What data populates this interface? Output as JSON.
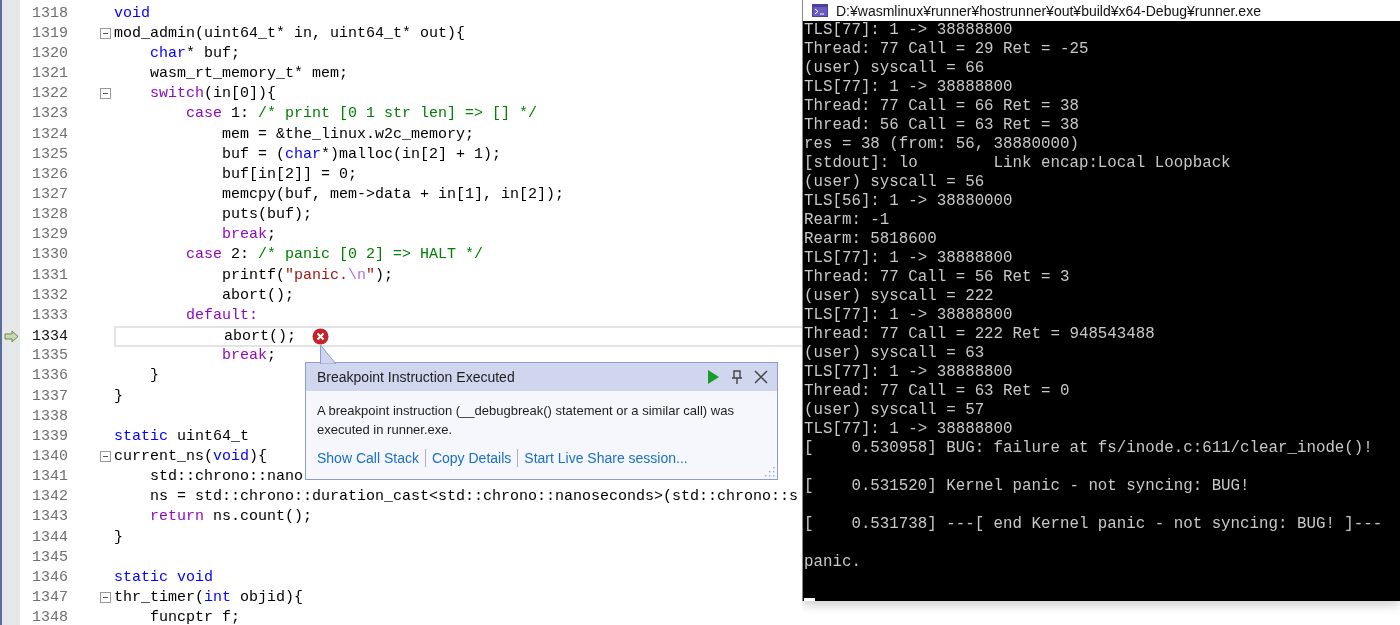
{
  "editor": {
    "lines": [
      {
        "number": "1318",
        "current": false,
        "fold": false,
        "error": false,
        "tokens": [
          {
            "kind": "keyword",
            "text": "void"
          }
        ]
      },
      {
        "number": "1319",
        "current": false,
        "fold": true,
        "error": false,
        "tokens": [
          {
            "kind": "plain",
            "text": "mod_admin(uint64_t* in, uint64_t* out){"
          }
        ]
      },
      {
        "number": "1320",
        "current": false,
        "fold": false,
        "error": false,
        "tokens": [
          {
            "kind": "keyword",
            "text": "    char"
          },
          {
            "kind": "plain",
            "text": "* buf;"
          }
        ]
      },
      {
        "number": "1321",
        "current": false,
        "fold": false,
        "error": false,
        "tokens": [
          {
            "kind": "plain",
            "text": "    wasm_rt_memory_t* mem;"
          }
        ]
      },
      {
        "number": "1322",
        "current": false,
        "fold": true,
        "error": false,
        "tokens": [
          {
            "kind": "control",
            "text": "    switch"
          },
          {
            "kind": "plain",
            "text": "(in[0]){"
          }
        ]
      },
      {
        "number": "1323",
        "current": false,
        "fold": false,
        "error": false,
        "tokens": [
          {
            "kind": "control",
            "text": "        case"
          },
          {
            "kind": "plain",
            "text": " 1: "
          },
          {
            "kind": "comment",
            "text": "/* print [0 1 str len] => [] */"
          }
        ]
      },
      {
        "number": "1324",
        "current": false,
        "fold": false,
        "error": false,
        "tokens": [
          {
            "kind": "plain",
            "text": "            mem = &the_linux.w2c_memory;"
          }
        ]
      },
      {
        "number": "1325",
        "current": false,
        "fold": false,
        "error": false,
        "tokens": [
          {
            "kind": "plain",
            "text": "            buf = ("
          },
          {
            "kind": "keyword",
            "text": "char"
          },
          {
            "kind": "plain",
            "text": "*)malloc(in[2] + 1);"
          }
        ]
      },
      {
        "number": "1326",
        "current": false,
        "fold": false,
        "error": false,
        "tokens": [
          {
            "kind": "plain",
            "text": "            buf[in[2]] = 0;"
          }
        ]
      },
      {
        "number": "1327",
        "current": false,
        "fold": false,
        "error": false,
        "tokens": [
          {
            "kind": "plain",
            "text": "            memcpy(buf, mem->data + in[1], in[2]);"
          }
        ]
      },
      {
        "number": "1328",
        "current": false,
        "fold": false,
        "error": false,
        "tokens": [
          {
            "kind": "plain",
            "text": "            puts(buf);"
          }
        ]
      },
      {
        "number": "1329",
        "current": false,
        "fold": false,
        "error": false,
        "tokens": [
          {
            "kind": "control",
            "text": "            break"
          },
          {
            "kind": "plain",
            "text": ";"
          }
        ]
      },
      {
        "number": "1330",
        "current": false,
        "fold": false,
        "error": false,
        "tokens": [
          {
            "kind": "control",
            "text": "        case"
          },
          {
            "kind": "plain",
            "text": " 2: "
          },
          {
            "kind": "comment",
            "text": "/* panic [0 2] => HALT */"
          }
        ]
      },
      {
        "number": "1331",
        "current": false,
        "fold": false,
        "error": false,
        "tokens": [
          {
            "kind": "plain",
            "text": "            printf("
          },
          {
            "kind": "string",
            "text": "\"panic."
          },
          {
            "kind": "escape",
            "text": "\\n"
          },
          {
            "kind": "string",
            "text": "\""
          },
          {
            "kind": "plain",
            "text": ");"
          }
        ]
      },
      {
        "number": "1332",
        "current": false,
        "fold": false,
        "error": false,
        "tokens": [
          {
            "kind": "plain",
            "text": "            abort();"
          }
        ]
      },
      {
        "number": "1333",
        "current": false,
        "fold": false,
        "error": false,
        "tokens": [
          {
            "kind": "control",
            "text": "        default:"
          }
        ]
      },
      {
        "number": "1334",
        "current": true,
        "fold": false,
        "error": true,
        "tokens": [
          {
            "kind": "plain",
            "text": "            abort();"
          }
        ]
      },
      {
        "number": "1335",
        "current": false,
        "fold": false,
        "error": false,
        "tokens": [
          {
            "kind": "control",
            "text": "            break"
          },
          {
            "kind": "plain",
            "text": ";"
          }
        ]
      },
      {
        "number": "1336",
        "current": false,
        "fold": false,
        "error": false,
        "tokens": [
          {
            "kind": "plain",
            "text": "    }"
          }
        ]
      },
      {
        "number": "1337",
        "current": false,
        "fold": false,
        "error": false,
        "tokens": [
          {
            "kind": "plain",
            "text": "}"
          }
        ]
      },
      {
        "number": "1338",
        "current": false,
        "fold": false,
        "error": false
      },
      {
        "number": "1339",
        "current": false,
        "fold": false,
        "error": false,
        "tokens": [
          {
            "kind": "keyword",
            "text": "static"
          },
          {
            "kind": "plain",
            "text": " uint64_t"
          }
        ]
      },
      {
        "number": "1340",
        "current": false,
        "fold": true,
        "error": false,
        "tokens": [
          {
            "kind": "plain",
            "text": "current_ns("
          },
          {
            "kind": "keyword",
            "text": "void"
          },
          {
            "kind": "plain",
            "text": "){"
          }
        ]
      },
      {
        "number": "1341",
        "current": false,
        "fold": false,
        "error": false,
        "tokens": [
          {
            "kind": "plain",
            "text": "    std::chrono::nano"
          }
        ]
      },
      {
        "number": "1342",
        "current": false,
        "fold": false,
        "error": false,
        "tokens": [
          {
            "kind": "plain",
            "text": "    ns = std::chrono::duration_cast<std::chrono::nanoseconds>(std::chrono::s"
          }
        ]
      },
      {
        "number": "1343",
        "current": false,
        "fold": false,
        "error": false,
        "tokens": [
          {
            "kind": "control",
            "text": "    return"
          },
          {
            "kind": "plain",
            "text": " ns.count();"
          }
        ]
      },
      {
        "number": "1344",
        "current": false,
        "fold": false,
        "error": false,
        "tokens": [
          {
            "kind": "plain",
            "text": "}"
          }
        ]
      },
      {
        "number": "1345",
        "current": false,
        "fold": false,
        "error": false
      },
      {
        "number": "1346",
        "current": false,
        "fold": false,
        "error": false,
        "tokens": [
          {
            "kind": "keyword",
            "text": "static void"
          }
        ]
      },
      {
        "number": "1347",
        "current": false,
        "fold": true,
        "error": false,
        "tokens": [
          {
            "kind": "plain",
            "text": "thr_timer("
          },
          {
            "kind": "keyword",
            "text": "int"
          },
          {
            "kind": "plain",
            "text": " objid){"
          }
        ]
      },
      {
        "number": "1348",
        "current": false,
        "fold": false,
        "error": false,
        "tokens": [
          {
            "kind": "plain",
            "text": "    funcptr f;"
          }
        ]
      }
    ],
    "exception_popup": {
      "title": "Breakpoint Instruction Executed",
      "message": "A breakpoint instruction (__debugbreak() statement or a similar call) was executed in runner.exe.",
      "links": [
        "Show Call Stack",
        "Copy Details",
        "Start Live Share session..."
      ]
    }
  },
  "console": {
    "title": "D:¥wasmlinux¥runner¥hostrunner¥out¥build¥x64-Debug¥runner.exe",
    "lines": [
      {
        "text": "TLS[77]: 1 -> 38888800",
        "blank_after": false
      },
      {
        "text": "Thread: 77 Call = 29 Ret = -25",
        "blank_after": false
      },
      {
        "text": "(user) syscall = 66",
        "blank_after": false
      },
      {
        "text": "TLS[77]: 1 -> 38888800",
        "blank_after": false
      },
      {
        "text": "Thread: 77 Call = 66 Ret = 38",
        "blank_after": false
      },
      {
        "text": "Thread: 56 Call = 63 Ret = 38",
        "blank_after": false
      },
      {
        "text": "res = 38 (from: 56, 38880000)",
        "blank_after": false
      },
      {
        "text": "[stdout]: lo        Link encap:Local Loopback",
        "blank_after": false
      },
      {
        "text": "(user) syscall = 56",
        "blank_after": false
      },
      {
        "text": "TLS[56]: 1 -> 38880000",
        "blank_after": false
      },
      {
        "text": "Rearm: -1",
        "blank_after": false
      },
      {
        "text": "Rearm: 5818600",
        "blank_after": false
      },
      {
        "text": "TLS[77]: 1 -> 38888800",
        "blank_after": false
      },
      {
        "text": "Thread: 77 Call = 56 Ret = 3",
        "blank_after": false
      },
      {
        "text": "(user) syscall = 222",
        "blank_after": false
      },
      {
        "text": "TLS[77]: 1 -> 38888800",
        "blank_after": false
      },
      {
        "text": "Thread: 77 Call = 222 Ret = 948543488",
        "blank_after": false
      },
      {
        "text": "(user) syscall = 63",
        "blank_after": false
      },
      {
        "text": "TLS[77]: 1 -> 38888800",
        "blank_after": false
      },
      {
        "text": "Thread: 77 Call = 63 Ret = 0",
        "blank_after": false
      },
      {
        "text": "(user) syscall = 57",
        "blank_after": false
      },
      {
        "text": "TLS[77]: 1 -> 38888800",
        "blank_after": false
      },
      {
        "text": "[    0.530958] BUG: failure at fs/inode.c:611/clear_inode()!",
        "blank_after": true
      },
      {
        "text": "[    0.531520] Kernel panic - not syncing: BUG!",
        "blank_after": true
      },
      {
        "text": "[    0.531738] ---[ end Kernel panic - not syncing: BUG! ]---",
        "blank_after": true
      },
      {
        "text": "panic.",
        "blank_after": true
      }
    ]
  }
}
